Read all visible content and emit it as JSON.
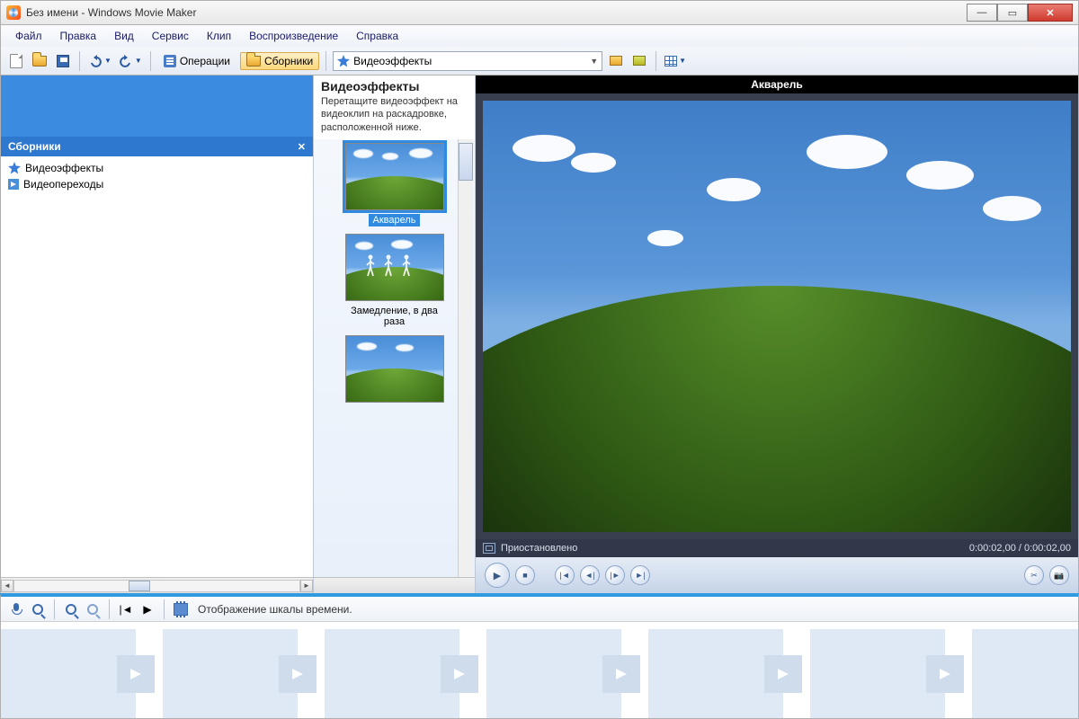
{
  "titlebar": {
    "title": "Без имени - Windows Movie Maker"
  },
  "menubar": {
    "file": "Файл",
    "edit": "Правка",
    "view": "Вид",
    "service": "Сервис",
    "clip": "Клип",
    "play": "Воспроизведение",
    "help": "Справка"
  },
  "toolbar": {
    "operations": "Операции",
    "collections": "Сборники"
  },
  "combo": {
    "label": "Видеоэффекты"
  },
  "sidebar": {
    "header": "Сборники",
    "items": [
      {
        "label": "Видеоэффекты"
      },
      {
        "label": "Видеопереходы"
      }
    ]
  },
  "effects": {
    "title": "Видеоэффекты",
    "desc": "Перетащите видеоэффект на видеоклип на раскадровке, расположенной ниже.",
    "items": [
      {
        "label": "Акварель",
        "selected": true
      },
      {
        "label": "Замедление, в два раза",
        "selected": false
      },
      {
        "label": "",
        "selected": false
      }
    ]
  },
  "preview": {
    "title": "Акварель",
    "status": "Приостановлено",
    "time": "0:00:02,00 / 0:00:02,00"
  },
  "timeline": {
    "label": "Отображение шкалы времени."
  }
}
